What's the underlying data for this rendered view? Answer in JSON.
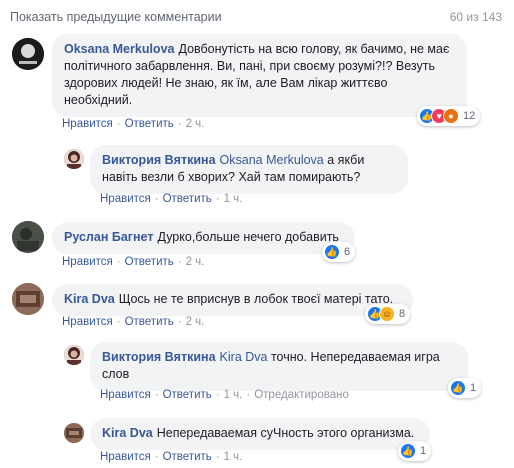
{
  "header": {
    "prev_comments": "Показать предыдущие комментарии",
    "counter": "60 из 143"
  },
  "actions": {
    "like": "Нравится",
    "reply": "Ответить",
    "edited": "Отредактировано"
  },
  "comments": [
    {
      "author": "Oksana Merkulova",
      "text": "Довбонутість на всю голову, як бачимо, не має політичного забарвлення. Ви, пані, при своєму розумі?!? Везуть здорових людей! Не знаю, як їм, але Вам лікар життєво необхідний.",
      "time": "2 ч.",
      "reactions": "12"
    },
    {
      "author": "Виктория Вяткина",
      "mention": "Oksana Merkulova",
      "text": "а якби навіть везли б хворих? Хай там помирають?",
      "time": "1 ч."
    },
    {
      "author": "Руслан Багнет",
      "text": "Дурко,больше нечего добавить",
      "time": "2 ч.",
      "reactions": "6"
    },
    {
      "author": "Kira Dva",
      "text": "Щось не те вприснув в лобок твоєї матері тато.",
      "time": "2 ч.",
      "reactions": "8"
    },
    {
      "author": "Виктория Вяткина",
      "mention": "Kira Dva",
      "text": "точно. Непередаваемая игра слов",
      "time": "1 ч.",
      "reactions": "1"
    },
    {
      "author": "Kira Dva",
      "text": "Непередаваемая суЧность этого организма.",
      "time": "1 ч.",
      "reactions": "1"
    }
  ]
}
